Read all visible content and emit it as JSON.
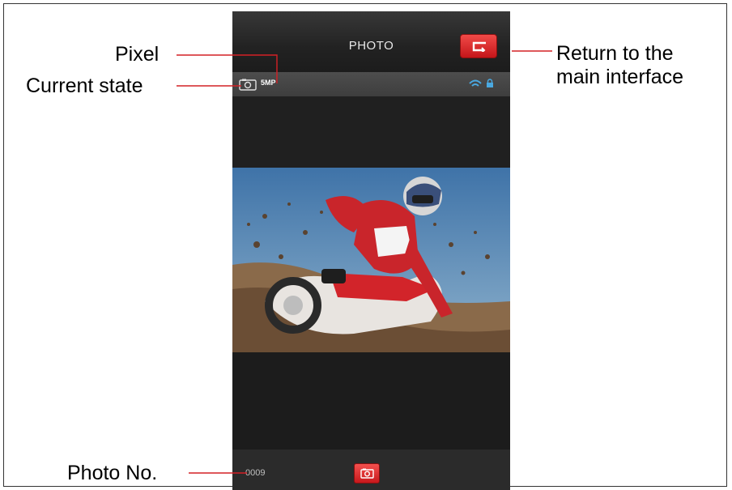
{
  "screen": {
    "title": "PHOTO",
    "pixel_value": "5MP",
    "photo_number": "0009",
    "accent_color": "#d42025",
    "icons": {
      "mode": "camera-mode-icon",
      "back": "return-arrow-icon",
      "wifi": "wifi-icon",
      "lock": "lock-icon",
      "shutter": "camera-shutter-icon"
    }
  },
  "callouts": {
    "pixel": "Pixel",
    "current_state": "Current state",
    "return_line1": "Return to the",
    "return_line2": "main interface",
    "photo_no": "Photo No."
  }
}
